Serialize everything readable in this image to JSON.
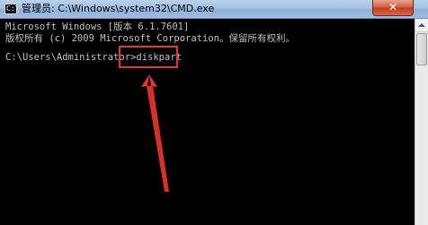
{
  "window": {
    "title": "管理员: C:\\Windows\\system32\\CMD.exe",
    "icon_label": "C:\\",
    "close_label": "✕"
  },
  "console": {
    "lines": [
      "Microsoft Windows [版本 6.1.7601]",
      "版权所有 (c) 2009 Microsoft Corporation。保留所有权利。",
      "",
      "C:\\Users\\Administrator>diskpart"
    ]
  },
  "annotation": {
    "color": "#e3382c"
  }
}
